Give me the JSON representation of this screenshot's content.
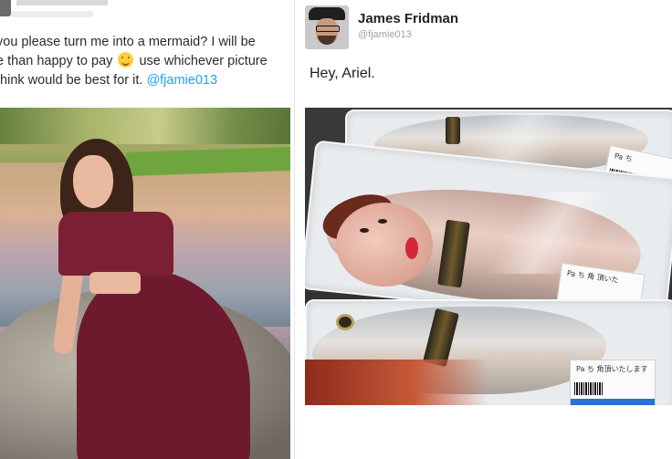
{
  "left_tweet": {
    "text_lines": [
      "you please turn me into a mermaid? I will be",
      "e than happy to pay",
      "use whichever picture",
      "think would be best for it."
    ],
    "mention": "@fjamie013",
    "emoji_icon": "smiling-face-icon"
  },
  "right_tweet": {
    "author_name": "James Fridman",
    "handle": "@fjamie013",
    "text": "Hey, Ariel."
  },
  "colors": {
    "mention_blue": "#1da1f2",
    "text": "#222222",
    "handle_gray": "#9aa5ae"
  }
}
